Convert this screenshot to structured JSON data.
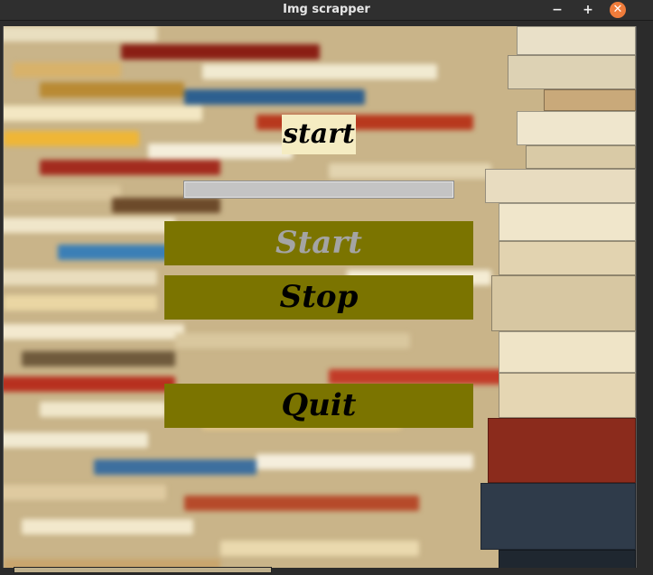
{
  "window": {
    "title": "Img scrapper",
    "minimize_glyph": "−",
    "maximize_glyph": "+",
    "close_glyph": "✕"
  },
  "status": {
    "label": "start"
  },
  "progress": {
    "value": 0
  },
  "buttons": {
    "start_label": "Start",
    "stop_label": "Stop",
    "quit_label": "Quit"
  },
  "colors": {
    "button_bg": "#7b7400",
    "status_bg": "#f5ecc2",
    "start_disabled_text": "#a4a4a4",
    "close_accent": "#ef7c3b"
  }
}
